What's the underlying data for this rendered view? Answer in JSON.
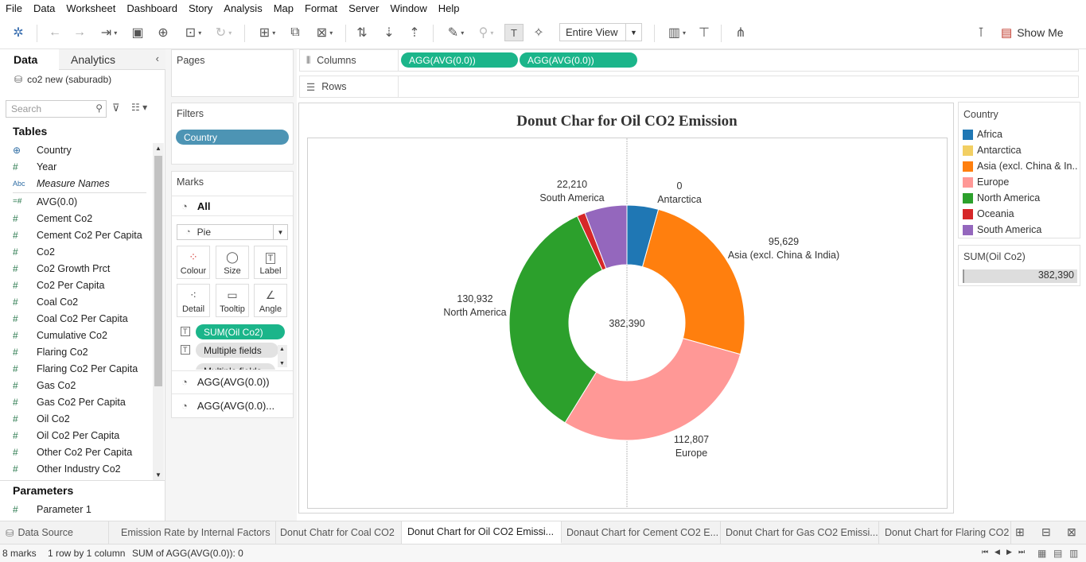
{
  "menu": [
    "File",
    "Data",
    "Worksheet",
    "Dashboard",
    "Story",
    "Analysis",
    "Map",
    "Format",
    "Server",
    "Window",
    "Help"
  ],
  "toolbar": {
    "view_mode": "Entire View",
    "show_me": "Show Me"
  },
  "left": {
    "tab_data": "Data",
    "tab_analytics": "Analytics",
    "datasource": "co2 new (saburadb)",
    "search_placeholder": "Search",
    "tables_header": "Tables",
    "dimensions": [
      {
        "icon": "globe",
        "name": "Country"
      },
      {
        "icon": "#",
        "name": "Year"
      },
      {
        "icon": "Abc",
        "name": "Measure Names"
      }
    ],
    "measures": [
      "AVG(0.0)",
      "Cement Co2",
      "Cement Co2 Per Capita",
      "Co2",
      "Co2 Growth Prct",
      "Co2 Per Capita",
      "Coal Co2",
      "Coal Co2 Per Capita",
      "Cumulative Co2",
      "Flaring Co2",
      "Flaring Co2 Per Capita",
      "Gas Co2",
      "Gas Co2 Per Capita",
      "Oil Co2",
      "Oil Co2 Per Capita",
      "Other Co2 Per Capita",
      "Other Industry Co2"
    ],
    "parameters_header": "Parameters",
    "parameters": [
      "Parameter 1"
    ]
  },
  "cards": {
    "pages": "Pages",
    "filters": "Filters",
    "filter_pills": [
      "Country"
    ],
    "marks": "Marks",
    "marks_all": "All",
    "mark_type": "Pie",
    "mark_buttons": [
      "Colour",
      "Size",
      "Label",
      "Detail",
      "Tooltip",
      "Angle"
    ],
    "mark_pills": [
      "SUM(Oil Co2)",
      "Multiple fields",
      "Multiple fields"
    ],
    "agg_cards": [
      "AGG(AVG(0.0))",
      "AGG(AVG(0.0)..."
    ]
  },
  "shelves": {
    "columns_label": "Columns",
    "rows_label": "Rows",
    "column_pills": [
      "AGG(AVG(0.0))",
      "AGG(AVG(0.0))"
    ]
  },
  "legend": {
    "title": "Country",
    "items": [
      {
        "name": "Africa",
        "color": "#1f77b4"
      },
      {
        "name": "Antarctica",
        "color": "#f2cf63"
      },
      {
        "name": "Asia (excl. China & In...",
        "color": "#ff7f0e"
      },
      {
        "name": "Europe",
        "color": "#ff9896"
      },
      {
        "name": "North America",
        "color": "#2ca02c"
      },
      {
        "name": "Oceania",
        "color": "#d62728"
      },
      {
        "name": "South America",
        "color": "#9467bd"
      }
    ],
    "sum_title": "SUM(Oil Co2)",
    "sum_value": "382,390"
  },
  "chart_data": {
    "type": "pie",
    "title": "Donut Char for Oil CO2 Emission",
    "center_label": "382,390",
    "slices": [
      {
        "name": "Africa",
        "value": 16500,
        "color": "#1f77b4"
      },
      {
        "name": "Antarctica",
        "value": 0,
        "color": "#f2cf63",
        "label": "0"
      },
      {
        "name": "Asia (excl. China & India)",
        "value": 95629,
        "color": "#ff7f0e",
        "label": "95,629"
      },
      {
        "name": "Europe",
        "value": 112807,
        "color": "#ff9896",
        "label": "112,807"
      },
      {
        "name": "North America",
        "value": 130932,
        "color": "#2ca02c",
        "label": "130,932"
      },
      {
        "name": "Oceania",
        "value": 4312,
        "color": "#d62728"
      },
      {
        "name": "South America",
        "value": 22210,
        "color": "#9467bd",
        "label": "22,210"
      }
    ]
  },
  "sheet_tabs": [
    {
      "name": "Data Source",
      "active": false
    },
    {
      "name": "Emission Rate by Internal Factors",
      "active": false
    },
    {
      "name": "Donut Chatr for Coal CO2",
      "active": false
    },
    {
      "name": "Donut Chart for Oil CO2 Emissi...",
      "active": true
    },
    {
      "name": "Donaut Chart for Cement CO2 E...",
      "active": false
    },
    {
      "name": "Donut Chart for Gas CO2 Emissi...",
      "active": false
    },
    {
      "name": "Donut Chart for Flaring CO2",
      "active": false
    }
  ],
  "status": {
    "marks": "8 marks",
    "dims": "1 row by 1 column",
    "sum": "SUM of AGG(AVG(0.0)): 0"
  }
}
